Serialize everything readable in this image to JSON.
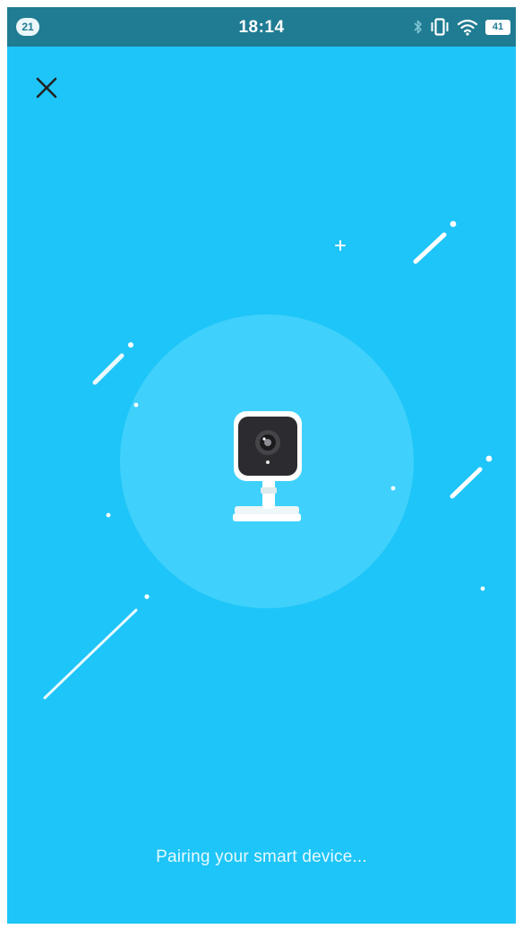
{
  "status_bar": {
    "notification_count": "21",
    "time": "18:14",
    "battery_level": "41",
    "icons": [
      "bluetooth-icon",
      "vibrate-icon",
      "wifi-icon",
      "battery-icon"
    ]
  },
  "header": {
    "close_icon": "close-icon"
  },
  "illustration": {
    "device": "camera-icon"
  },
  "status_message": "Pairing your smart device...",
  "colors": {
    "background": "#1ec5f8",
    "status_bar": "#1f7c92",
    "halo": "#45d2fb",
    "white": "#ffffff"
  }
}
